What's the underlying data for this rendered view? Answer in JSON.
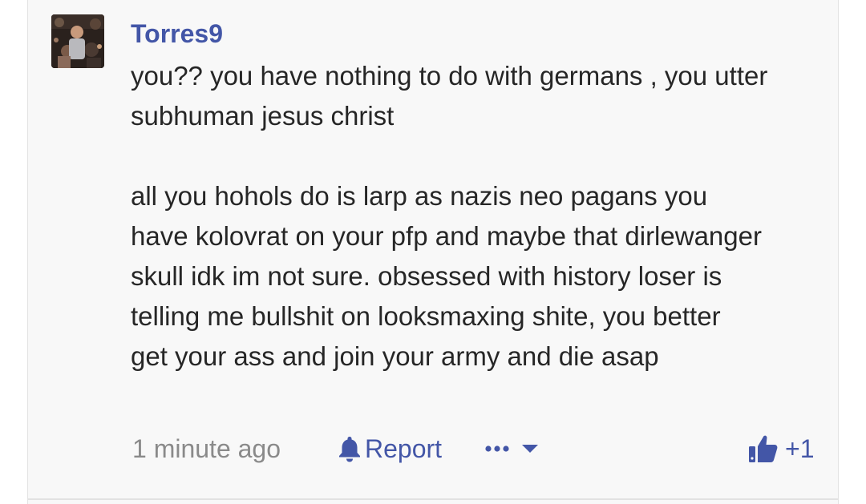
{
  "comment": {
    "author": "Torres9",
    "paragraphs": [
      "you?? you have nothing to do with germans , you utter\nsubhuman jesus christ",
      "all you hohols do is larp as nazis neo pagans you\nhave kolovrat on your pfp and maybe that dirlewanger\nskull idk im not sure. obsessed with history loser is\ntelling me bullshit on looksmaxing shite, you better\nget your ass and join your army and die asap"
    ],
    "timestamp": "1 minute ago",
    "report_label": "Report",
    "vote_count": "+1"
  },
  "icons": {
    "report": "bell-icon",
    "more": "ellipsis-icon",
    "dropdown": "caret-down-icon",
    "upvote": "thumbs-up-icon"
  },
  "colors": {
    "accent": "#4356a7",
    "text": "#262626",
    "muted": "#8a8a8a",
    "card_bg": "#f8f8f8"
  }
}
